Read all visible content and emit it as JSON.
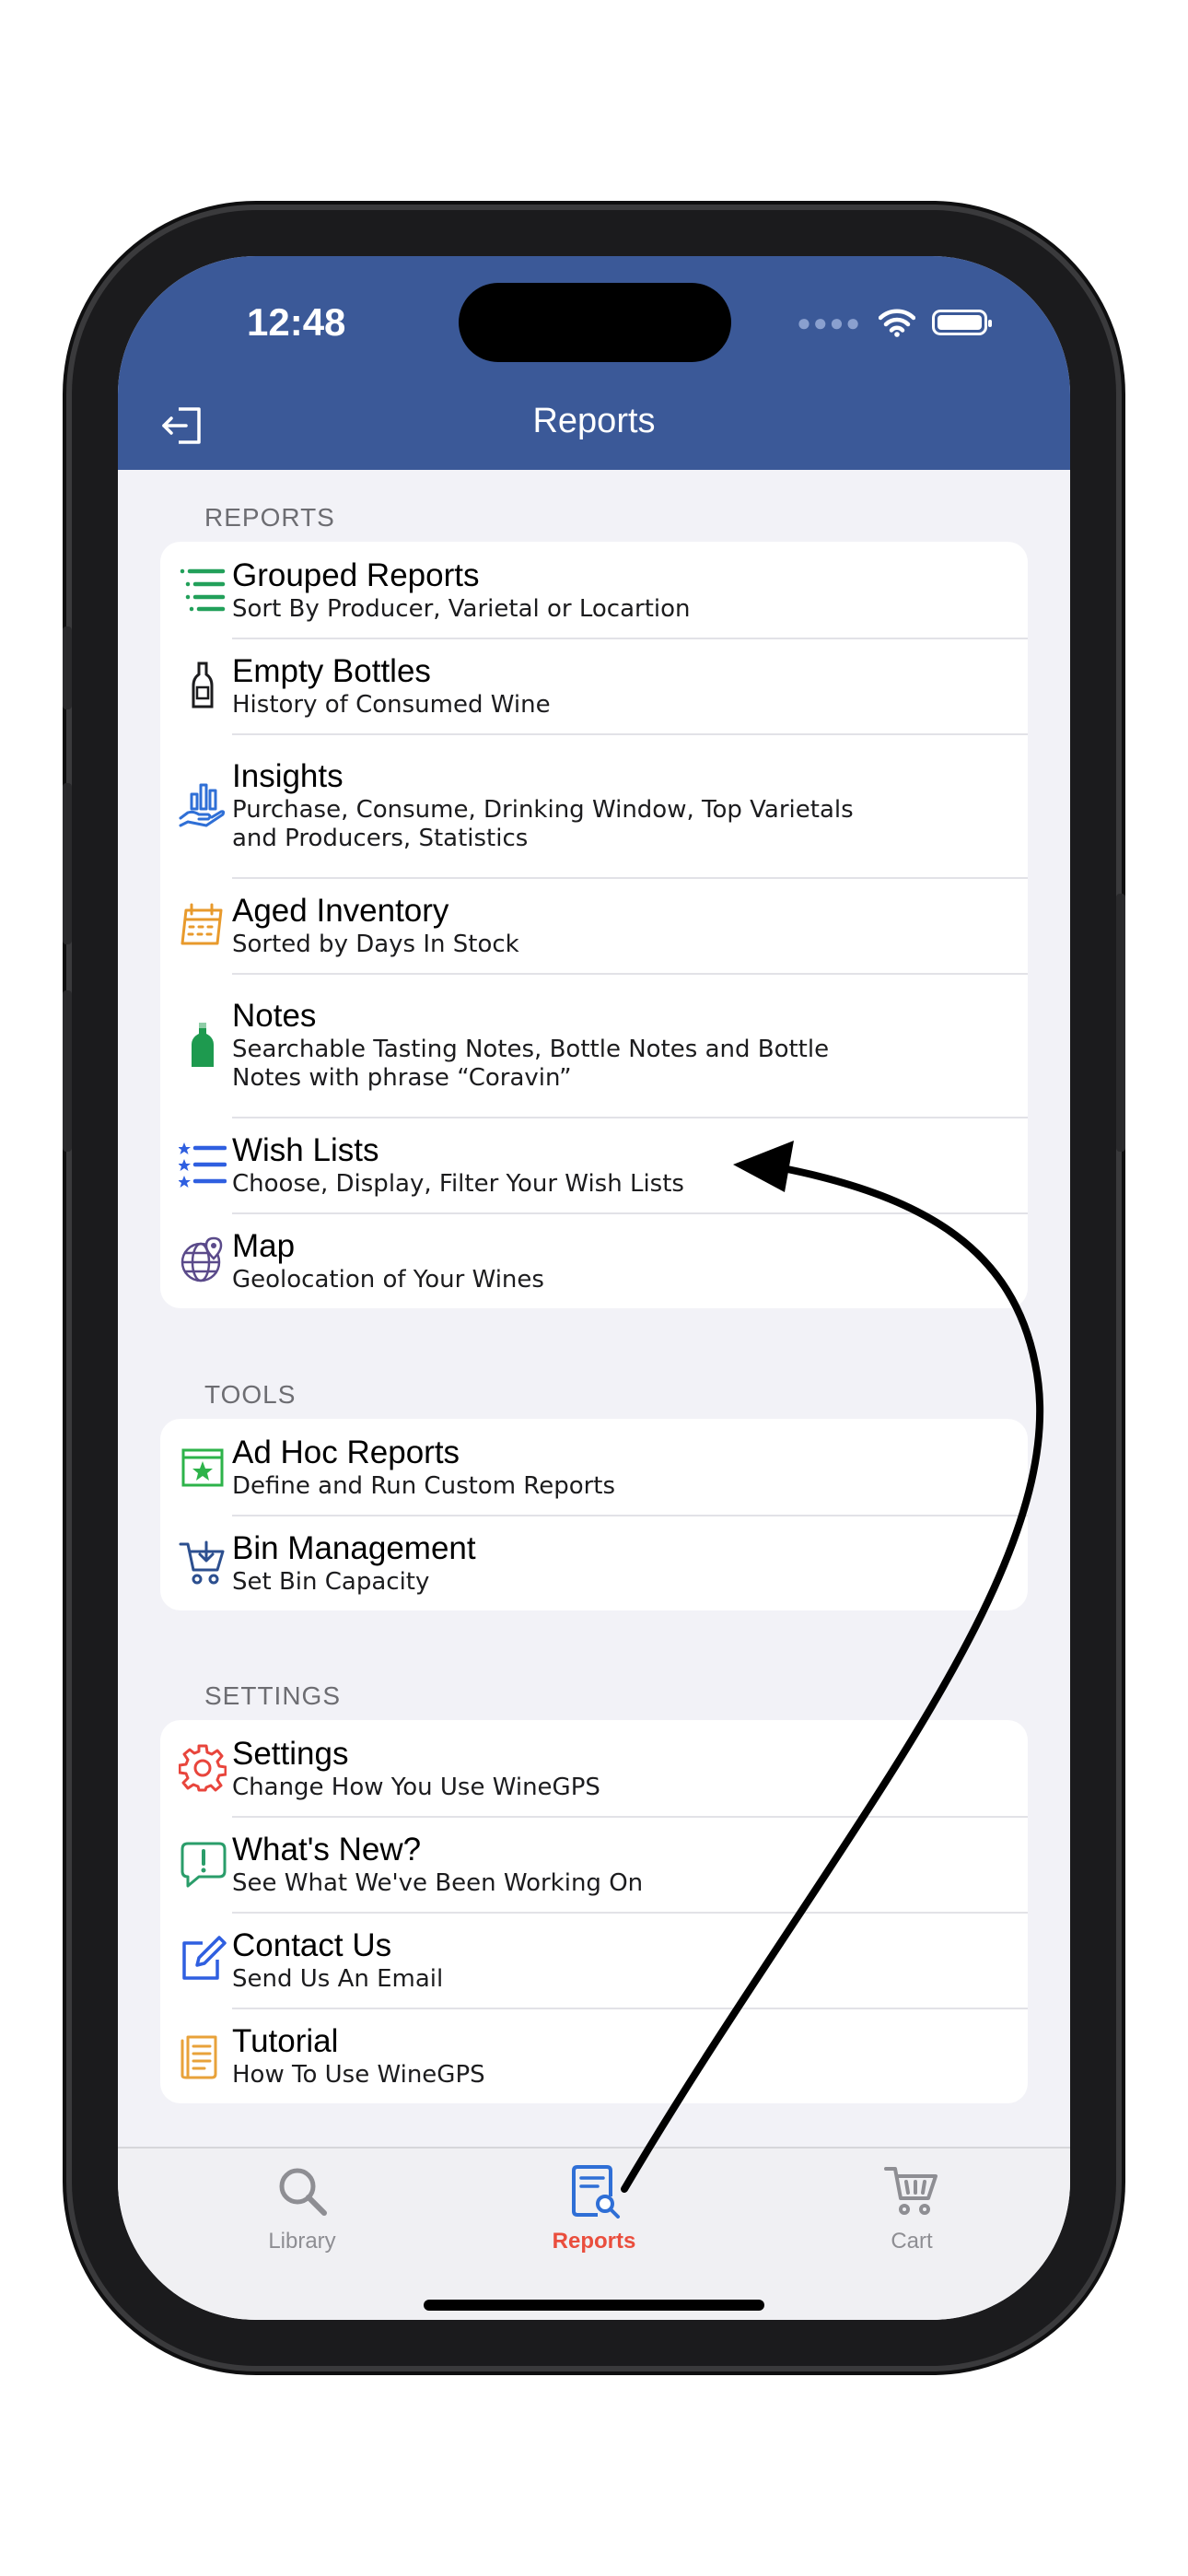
{
  "status_bar": {
    "time": "12:48"
  },
  "header": {
    "title": "Reports"
  },
  "sections": [
    {
      "label": "REPORTS",
      "items": [
        {
          "icon": "grouped-list-icon",
          "label": "Grouped Reports",
          "sub": "Sort By Producer, Varietal or Locartion"
        },
        {
          "icon": "wine-bottle-icon",
          "label": "Empty Bottles",
          "sub": "History of Consumed Wine"
        },
        {
          "icon": "chart-hand-icon",
          "label": "Insights",
          "sub": "Purchase, Consume, Drinking Window, Top Varietals and Producers, Statistics"
        },
        {
          "icon": "calendar-icon",
          "label": "Aged Inventory",
          "sub": "Sorted by Days In Stock"
        },
        {
          "icon": "green-bottle-icon",
          "label": "Notes",
          "sub": "Searchable Tasting Notes, Bottle Notes and Bottle Notes with phrase “Coravin”"
        },
        {
          "icon": "star-list-icon",
          "label": "Wish Lists",
          "sub": "Choose, Display, Filter Your Wish Lists"
        },
        {
          "icon": "globe-pin-icon",
          "label": "Map",
          "sub": "Geolocation of Your Wines"
        }
      ]
    },
    {
      "label": "TOOLS",
      "items": [
        {
          "icon": "star-box-icon",
          "label": "Ad Hoc Reports",
          "sub": "Define and Run Custom Reports"
        },
        {
          "icon": "cart-down-icon",
          "label": "Bin Management",
          "sub": "Set Bin Capacity"
        }
      ]
    },
    {
      "label": "SETTINGS",
      "items": [
        {
          "icon": "gear-icon",
          "label": "Settings",
          "sub": "Change How You Use WineGPS"
        },
        {
          "icon": "speech-alert-icon",
          "label": "What's New?",
          "sub": "See What We've Been Working On"
        },
        {
          "icon": "compose-icon",
          "label": "Contact Us",
          "sub": "Send Us An Email"
        },
        {
          "icon": "notepad-icon",
          "label": "Tutorial",
          "sub": "How To Use WineGPS"
        }
      ]
    }
  ],
  "tabs": [
    {
      "icon": "search-icon",
      "label": "Library",
      "active": false
    },
    {
      "icon": "report-search-icon",
      "label": "Reports",
      "active": true
    },
    {
      "icon": "cart-icon",
      "label": "Cart",
      "active": false
    }
  ],
  "colors": {
    "header": "#3b5998",
    "active_tab": "#ea4e3d",
    "inactive_tab": "#8e8e93"
  }
}
